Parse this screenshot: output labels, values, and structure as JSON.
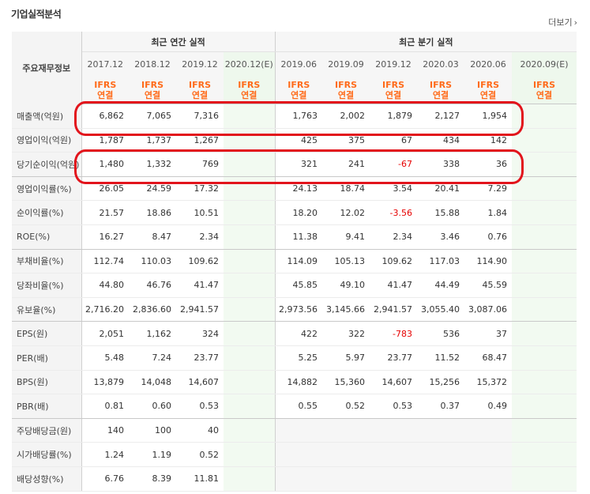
{
  "header": {
    "title": "기업실적분석",
    "more_label": "더보기",
    "more_icon": "chevron-right-icon"
  },
  "table": {
    "row_label_header": "주요재무정보",
    "annual_group": "최근 연간 실적",
    "quarter_group": "최근 분기 실적",
    "annual_periods": [
      "2017.12",
      "2018.12",
      "2019.12",
      "2020.12(E)"
    ],
    "quarter_periods": [
      "2019.06",
      "2019.09",
      "2019.12",
      "2020.03",
      "2020.06",
      "2020.09(E)"
    ],
    "ifrs_top": "IFRS",
    "ifrs_bottom": "연결",
    "rows": [
      {
        "label": "매출액(억원)",
        "annual": [
          "6,862",
          "7,065",
          "7,316",
          ""
        ],
        "quarter": [
          "1,763",
          "2,002",
          "1,879",
          "2,127",
          "1,954",
          ""
        ]
      },
      {
        "label": "영업이익(억원)",
        "annual": [
          "1,787",
          "1,737",
          "1,267",
          ""
        ],
        "quarter": [
          "425",
          "375",
          "67",
          "434",
          "142",
          ""
        ]
      },
      {
        "label": "당기순이익(억원)",
        "annual": [
          "1,480",
          "1,332",
          "769",
          ""
        ],
        "quarter": [
          "321",
          "241",
          "-67",
          "338",
          "36",
          ""
        ]
      },
      {
        "label": "영업이익률(%)",
        "annual": [
          "26.05",
          "24.59",
          "17.32",
          ""
        ],
        "quarter": [
          "24.13",
          "18.74",
          "3.54",
          "20.41",
          "7.29",
          ""
        ]
      },
      {
        "label": "순이익률(%)",
        "annual": [
          "21.57",
          "18.86",
          "10.51",
          ""
        ],
        "quarter": [
          "18.20",
          "12.02",
          "-3.56",
          "15.88",
          "1.84",
          ""
        ]
      },
      {
        "label": "ROE(%)",
        "annual": [
          "16.27",
          "8.47",
          "2.34",
          ""
        ],
        "quarter": [
          "11.38",
          "9.41",
          "2.34",
          "3.46",
          "0.76",
          ""
        ]
      },
      {
        "label": "부채비율(%)",
        "annual": [
          "112.74",
          "110.03",
          "109.62",
          ""
        ],
        "quarter": [
          "114.09",
          "105.13",
          "109.62",
          "117.03",
          "114.90",
          ""
        ]
      },
      {
        "label": "당좌비율(%)",
        "annual": [
          "44.80",
          "46.76",
          "41.47",
          ""
        ],
        "quarter": [
          "45.85",
          "49.10",
          "41.47",
          "44.49",
          "45.59",
          ""
        ]
      },
      {
        "label": "유보율(%)",
        "annual": [
          "2,716.20",
          "2,836.60",
          "2,941.57",
          ""
        ],
        "quarter": [
          "2,973.56",
          "3,145.66",
          "2,941.57",
          "3,055.40",
          "3,087.06",
          ""
        ]
      },
      {
        "label": "EPS(원)",
        "annual": [
          "2,051",
          "1,162",
          "324",
          ""
        ],
        "quarter": [
          "422",
          "322",
          "-783",
          "536",
          "37",
          ""
        ]
      },
      {
        "label": "PER(배)",
        "annual": [
          "5.48",
          "7.24",
          "23.77",
          ""
        ],
        "quarter": [
          "5.25",
          "5.97",
          "23.77",
          "11.52",
          "68.47",
          ""
        ]
      },
      {
        "label": "BPS(원)",
        "annual": [
          "13,879",
          "14,048",
          "14,607",
          ""
        ],
        "quarter": [
          "14,882",
          "15,360",
          "14,607",
          "15,256",
          "15,372",
          ""
        ]
      },
      {
        "label": "PBR(배)",
        "annual": [
          "0.81",
          "0.60",
          "0.53",
          ""
        ],
        "quarter": [
          "0.55",
          "0.52",
          "0.53",
          "0.37",
          "0.49",
          ""
        ]
      },
      {
        "label": "주당배당금(원)",
        "annual": [
          "140",
          "100",
          "40",
          ""
        ],
        "quarter": [
          "",
          "",
          "",
          "",
          "",
          ""
        ]
      },
      {
        "label": "시가배당률(%)",
        "annual": [
          "1.24",
          "1.19",
          "0.52",
          ""
        ],
        "quarter": [
          "",
          "",
          "",
          "",
          "",
          ""
        ]
      },
      {
        "label": "배당성향(%)",
        "annual": [
          "6.76",
          "8.39",
          "11.81",
          ""
        ],
        "quarter": [
          "",
          "",
          "",
          "",
          "",
          ""
        ]
      }
    ]
  },
  "highlights": [
    "매출액(억원)",
    "당기순이익(억원)"
  ],
  "colors": {
    "ifrs": "#ff6b1a",
    "negative": "#e60000",
    "annotation": "#e2141c",
    "estimate_bg": "#f2faf1"
  }
}
